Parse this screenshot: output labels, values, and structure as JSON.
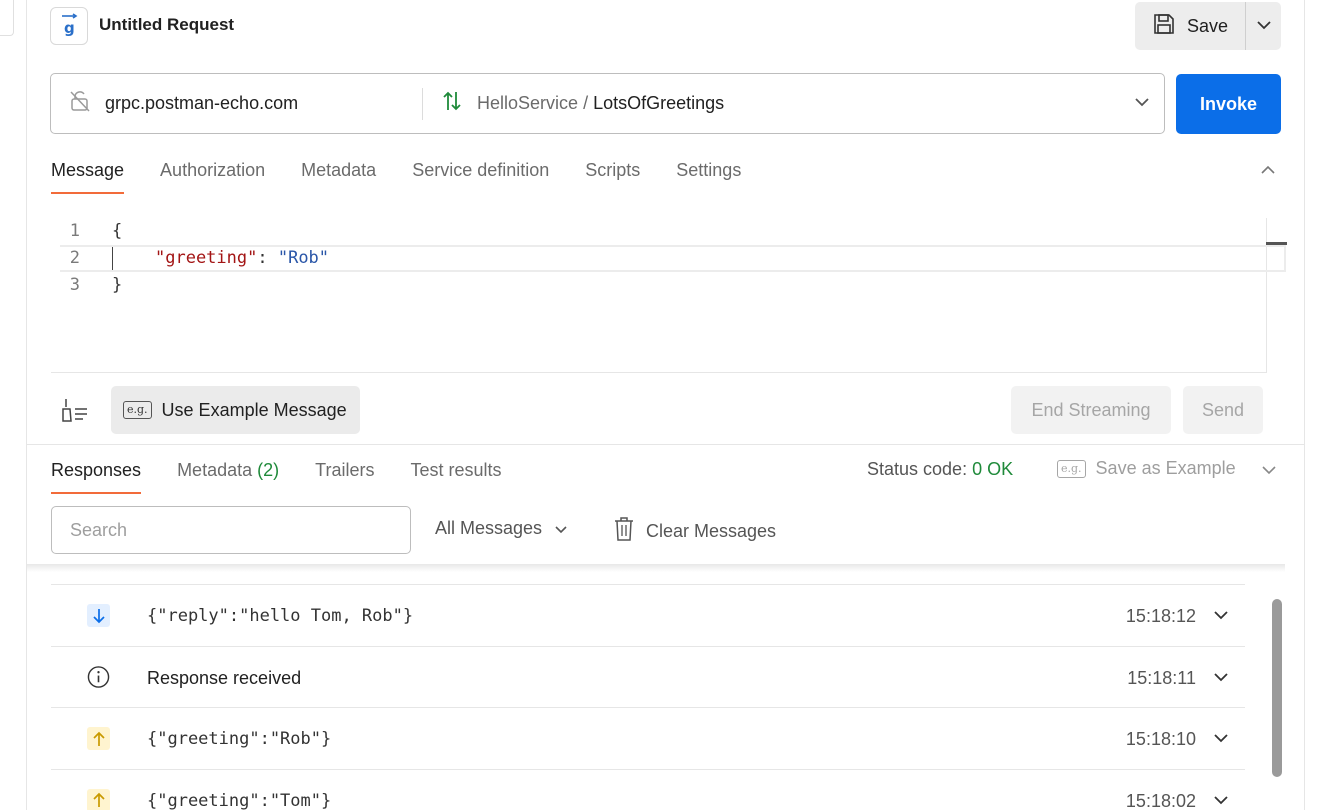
{
  "header": {
    "title": "Untitled Request",
    "save_label": "Save"
  },
  "url_bar": {
    "host": "grpc.postman-echo.com",
    "service": "HelloService",
    "separator": "/",
    "method": "LotsOfGreetings",
    "invoke_label": "Invoke"
  },
  "request_tabs": [
    {
      "label": "Message",
      "active": true
    },
    {
      "label": "Authorization",
      "active": false
    },
    {
      "label": "Metadata",
      "active": false
    },
    {
      "label": "Service definition",
      "active": false
    },
    {
      "label": "Scripts",
      "active": false
    },
    {
      "label": "Settings",
      "active": false
    }
  ],
  "editor": {
    "line_numbers": [
      "1",
      "2",
      "3"
    ],
    "line1": "{",
    "line2_key": "\"greeting\"",
    "line2_colon": ": ",
    "line2_value": "\"Rob\"",
    "line3": "}"
  },
  "message_actions": {
    "example_badge": "e.g.",
    "use_example_label": "Use Example Message",
    "end_streaming_label": "End Streaming",
    "send_label": "Send"
  },
  "response_tabs": [
    {
      "label": "Responses",
      "count": "",
      "active": true
    },
    {
      "label": "Metadata",
      "count": "(2)",
      "active": false
    },
    {
      "label": "Trailers",
      "count": "",
      "active": false
    },
    {
      "label": "Test results",
      "count": "",
      "active": false
    }
  ],
  "status": {
    "label": "Status code:",
    "value": "0 OK"
  },
  "save_as_example": {
    "badge": "e.g.",
    "label": "Save as Example"
  },
  "toolbar": {
    "search_placeholder": "Search",
    "filter_label": "All Messages",
    "clear_label": "Clear Messages"
  },
  "messages": [
    {
      "kind": "received",
      "icon": "arrow-down-icon",
      "text": "{\"reply\":\"hello Tom, Rob\"}",
      "time": "15:18:12"
    },
    {
      "kind": "info",
      "icon": "info-icon",
      "text": "Response received",
      "time": "15:18:11"
    },
    {
      "kind": "sent",
      "icon": "arrow-up-icon",
      "text": "{\"greeting\":\"Rob\"}",
      "time": "15:18:10"
    },
    {
      "kind": "sent",
      "icon": "arrow-up-icon",
      "text": "{\"greeting\":\"Tom\"}",
      "time": "15:18:02"
    }
  ],
  "colors": {
    "accent": "#0b6ee8",
    "tab_indicator": "#f26b3a",
    "status_ok": "#1f8a3a"
  }
}
